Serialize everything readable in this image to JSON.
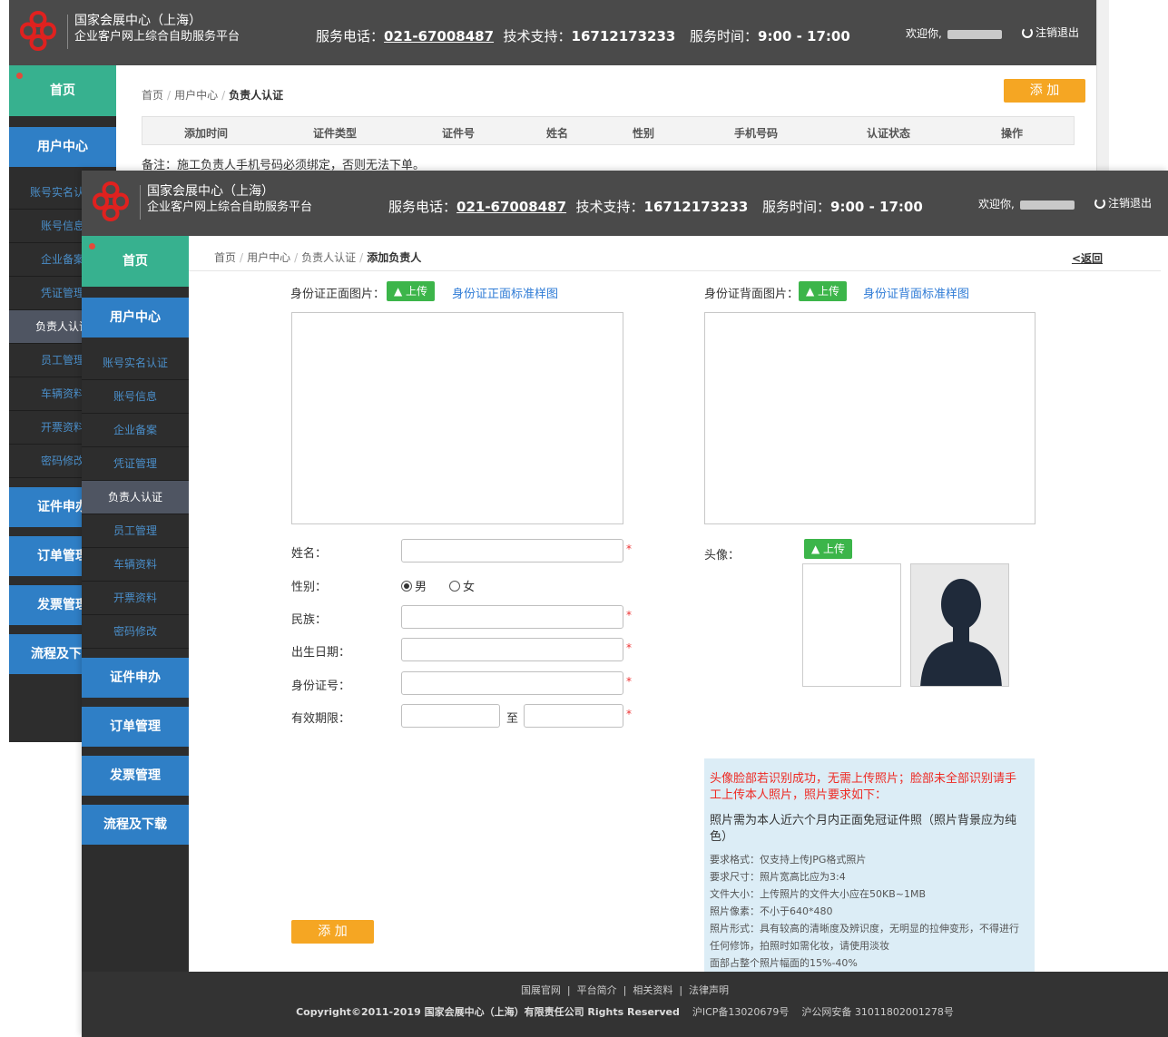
{
  "header": {
    "org_name": "国家会展中心（上海）",
    "platform_name": "企业客户网上综合自助服务平台",
    "service_label": "服务电话：",
    "service_phone": "021-67008487",
    "tech_label": "技术支持：",
    "tech_phone": "16712173233",
    "hours_label": "服务时间：",
    "hours": "9:00 - 17:00",
    "welcome": "欢迎你,",
    "logout": "注销退出"
  },
  "sidebar": {
    "home": "首页",
    "user_center": "用户中心",
    "sub_items": [
      "账号实名认证",
      "账号信息",
      "企业备案",
      "凭证管理",
      "负责人认证",
      "员工管理",
      "车辆资料",
      "开票资料",
      "密码修改"
    ],
    "cert": "证件申办",
    "orders": "订单管理",
    "invoices": "发票管理",
    "process": "流程及下载"
  },
  "list_page": {
    "breadcrumb": [
      "首页",
      "用户中心",
      "负责人认证"
    ],
    "add_button": "添 加",
    "columns": [
      "添加时间",
      "证件类型",
      "证件号",
      "姓名",
      "性别",
      "手机号码",
      "认证状态",
      "操作"
    ],
    "note": "备注：施工负责人手机号码必须绑定，否则无法下单。"
  },
  "form_page": {
    "breadcrumb": [
      "首页",
      "用户中心",
      "负责人认证",
      "添加负责人"
    ],
    "back": "<返回",
    "id_front_label": "身份证正面图片：",
    "id_back_label": "身份证背面图片：",
    "upload_label": "上传",
    "front_sample": "身份证正面标准样图",
    "back_sample": "身份证背面标准样图",
    "name_label": "姓名：",
    "gender_label": "性别：",
    "gender_male": "男",
    "gender_female": "女",
    "ethnicity_label": "民族：",
    "birth_label": "出生日期：",
    "idno_label": "身份证号：",
    "validity_label": "有效期限：",
    "validity_to": "至",
    "avatar_label": "头像：",
    "required_mark": "*",
    "submit": "添 加",
    "info_red": "头像脸部若识别成功，无需上传照片；脸部未全部识别请手工上传本人照片，照片要求如下：",
    "info_main": "照片需为本人近六个月内正面免冠证件照（照片背景应为纯色）",
    "info_requirements": [
      "要求格式：仅支持上传JPG格式照片",
      "要求尺寸：照片宽高比应为3:4",
      "文件大小：上传照片的文件大小应在50KB~1MB",
      "照片像素：不小于640*480",
      "照片形式：具有较高的清晰度及辨识度，无明显的拉伸变形，不得进行任何修饰，拍照时如需化妆，请使用淡妆",
      "面部占整个照片幅面的15%-40%"
    ]
  },
  "footer": {
    "links": [
      "国展官网",
      "平台简介",
      "相关资料",
      "法律声明"
    ],
    "copyright": "Copyright©2011-2019 国家会展中心（上海）有限责任公司 Rights Reserved",
    "icp": "沪ICP备13020679号",
    "police": "沪公网安备 31011802001278号"
  },
  "colors": {
    "header_bg": "#4a4a4a",
    "home_green": "#37b18f",
    "menu_blue": "#2f7fc6",
    "accent_orange": "#f5a623",
    "upload_green": "#3cb54a",
    "info_bg": "#dcedf6"
  }
}
